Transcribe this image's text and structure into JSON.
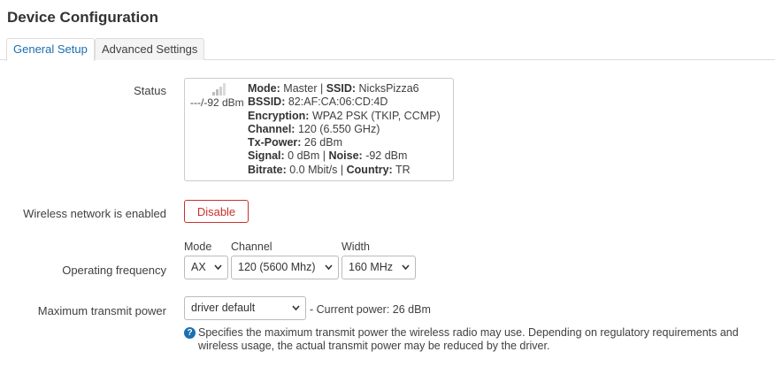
{
  "page": {
    "title": "Device Configuration"
  },
  "tabs": [
    {
      "label": "General Setup",
      "active": true
    },
    {
      "label": "Advanced Settings",
      "active": false
    }
  ],
  "status": {
    "label": "Status",
    "signal_text": "---/-92 dBm",
    "mode_label": "Mode:",
    "mode_value": "Master",
    "ssid_label": "SSID:",
    "ssid_value": "NicksPizza6",
    "bssid_label": "BSSID:",
    "bssid_value": "82:AF:CA:06:CD:4D",
    "encryption_label": "Encryption:",
    "encryption_value": "WPA2 PSK (TKIP, CCMP)",
    "channel_label": "Channel:",
    "channel_value": "120 (6.550 GHz)",
    "txpower_label": "Tx-Power:",
    "txpower_value": "26 dBm",
    "signal_label": "Signal:",
    "signal_value": "0 dBm",
    "noise_label": "Noise:",
    "noise_value": "-92 dBm",
    "bitrate_label": "Bitrate:",
    "bitrate_value": "0.0 Mbit/s",
    "country_label": "Country:",
    "country_value": "TR",
    "separator": " | "
  },
  "wireless": {
    "label": "Wireless network is enabled",
    "button_label": "Disable"
  },
  "frequency": {
    "label": "Operating frequency",
    "mode_label": "Mode",
    "mode_value": "AX",
    "channel_label": "Channel",
    "channel_value": "120 (5600 Mhz)",
    "width_label": "Width",
    "width_value": "160 MHz"
  },
  "txpower": {
    "label": "Maximum transmit power",
    "select_value": "driver default",
    "current_power": "- Current power: 26 dBm",
    "help_icon": "?",
    "help_text": "Specifies the maximum transmit power the wireless radio may use. Depending on regulatory requirements and wireless usage, the actual transmit power may be reduced by the driver."
  },
  "colors": {
    "accent": "#1a6fb0",
    "danger": "#c9302c",
    "border": "#dddddd"
  },
  "icons": {
    "signal": "signal-strength-icon",
    "help": "help-icon",
    "dropdown": "chevron-down-icon"
  }
}
